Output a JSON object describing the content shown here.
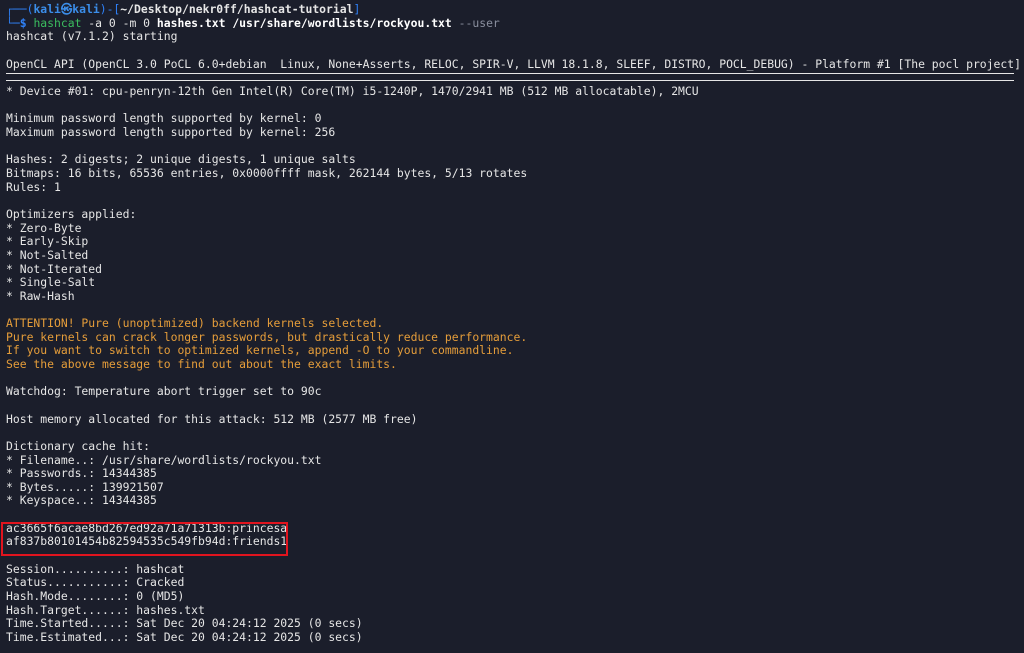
{
  "prompt": {
    "frame_top": "┌──(",
    "user": "kali",
    "at": "㉿",
    "host": "kali",
    "frame_mid": ")-[",
    "dir": "~/Desktop/nekr0ff/hashcat-tutorial",
    "frame_end": "]",
    "frame_bottom": "└─",
    "symbol": "$ ",
    "cmd_bin": "hashcat",
    "cmd_flags": " -a 0 -m 0 ",
    "cmd_arg1": "hashes.txt",
    "cmd_space": " ",
    "cmd_arg2": "/usr/share/wordlists/rockyou.txt",
    "cmd_opt": " --user"
  },
  "output": {
    "starting": "hashcat (v7.1.2) starting",
    "opencl": "OpenCL API (OpenCL 3.0 PoCL 6.0+debian  Linux, None+Asserts, RELOC, SPIR-V, LLVM 18.1.8, SLEEF, DISTRO, POCL_DEBUG) - Platform #1 [The pocl project]",
    "device": "* Device #01: cpu-penryn-12th Gen Intel(R) Core(TM) i5-1240P, 1470/2941 MB (512 MB allocatable), 2MCU",
    "min_pw": "Minimum password length supported by kernel: 0",
    "max_pw": "Maximum password length supported by kernel: 256",
    "hashes": "Hashes: 2 digests; 2 unique digests, 1 unique salts",
    "bitmaps": "Bitmaps: 16 bits, 65536 entries, 0x0000ffff mask, 262144 bytes, 5/13 rotates",
    "rules": "Rules: 1",
    "optimizers_title": "Optimizers applied:",
    "optimizers": [
      "* Zero-Byte",
      "* Early-Skip",
      "* Not-Salted",
      "* Not-Iterated",
      "* Single-Salt",
      "* Raw-Hash"
    ],
    "attention": [
      "ATTENTION! Pure (unoptimized) backend kernels selected.",
      "Pure kernels can crack longer passwords, but drastically reduce performance.",
      "If you want to switch to optimized kernels, append -O to your commandline.",
      "See the above message to find out about the exact limits."
    ],
    "watchdog": "Watchdog: Temperature abort trigger set to 90c",
    "host_memory": "Host memory allocated for this attack: 512 MB (2577 MB free)",
    "dict_title": "Dictionary cache hit:",
    "dict": [
      "* Filename..: /usr/share/wordlists/rockyou.txt",
      "* Passwords.: 14344385",
      "* Bytes.....: 139921507",
      "* Keyspace..: 14344385"
    ],
    "cracked": [
      "ac3665f6acae8bd267ed92a71a71313b:princesa",
      "af837b80101454b82594535c549fb94d:friends1"
    ],
    "status": [
      "Session..........: hashcat",
      "Status...........: Cracked",
      "Hash.Mode........: 0 (MD5)",
      "Hash.Target......: hashes.txt",
      "Time.Started.....: Sat Dec 20 04:24:12 2025 (0 secs)",
      "Time.Estimated...: Sat Dec 20 04:24:12 2025 (0 secs)"
    ]
  },
  "colors": {
    "background": "#1b1e2b",
    "prompt_blue": "#2f81f7",
    "command_green": "#3bbd5f",
    "warning_orange": "#e59d3a",
    "highlight_red": "#e1141e"
  }
}
